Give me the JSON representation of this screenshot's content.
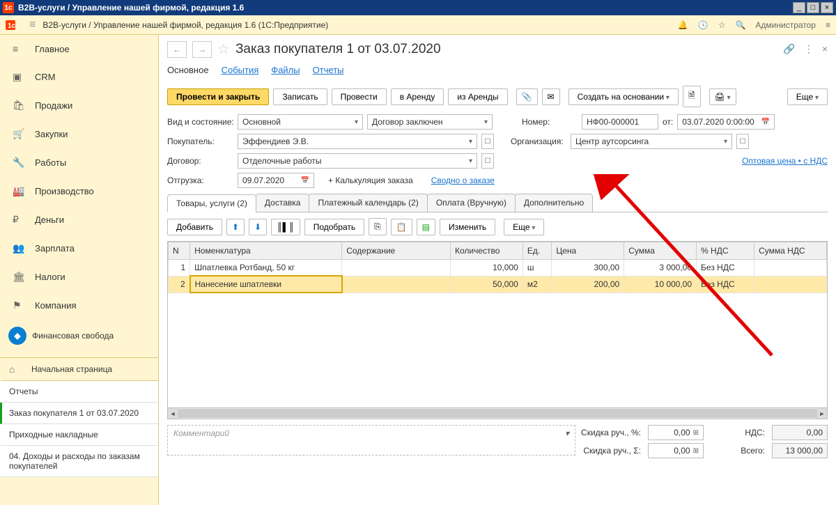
{
  "window": {
    "title": "B2B-услуги / Управление нашей фирмой, редакция 1.6"
  },
  "header": {
    "breadcrumb": "B2B-услуги / Управление нашей фирмой, редакция 1.6  (1С:Предприятие)",
    "user": "Администратор"
  },
  "sidebar": {
    "items": [
      {
        "label": "Главное",
        "icon": "≡"
      },
      {
        "label": "CRM",
        "icon": "▣"
      },
      {
        "label": "Продажи",
        "icon": "🛍"
      },
      {
        "label": "Закупки",
        "icon": "🛒"
      },
      {
        "label": "Работы",
        "icon": "🔧"
      },
      {
        "label": "Производство",
        "icon": "🏭"
      },
      {
        "label": "Деньги",
        "icon": "₽"
      },
      {
        "label": "Зарплата",
        "icon": "👥"
      },
      {
        "label": "Налоги",
        "icon": "🏛"
      },
      {
        "label": "Компания",
        "icon": "⚑"
      }
    ],
    "fin_free": "Финансовая свобода",
    "bottom": [
      {
        "label": "Начальная страница",
        "home": true
      },
      {
        "label": "Отчеты"
      },
      {
        "label": "Заказ покупателя 1 от 03.07.2020",
        "active": true
      },
      {
        "label": "Приходные накладные"
      },
      {
        "label": "04. Доходы и расходы по заказам покупателей"
      }
    ]
  },
  "document": {
    "title": "Заказ покупателя 1 от 03.07.2020",
    "sub_tabs": [
      "Основное",
      "События",
      "Файлы",
      "Отчеты"
    ],
    "actions": {
      "post_close": "Провести и закрыть",
      "save": "Записать",
      "post": "Провести",
      "to_rent": "в Аренду",
      "from_rent": "из Аренды",
      "create_based": "Создать на основании",
      "more": "Еще"
    },
    "fields": {
      "type_state_label": "Вид и состояние:",
      "type": "Основной",
      "state": "Договор заключен",
      "number_label": "Номер:",
      "number": "НФ00-000001",
      "from_label": "от:",
      "date": "03.07.2020  0:00:00",
      "buyer_label": "Покупатель:",
      "buyer": "Эффендиев Э.В.",
      "org_label": "Организация:",
      "org": "Центр аутсорсинга",
      "contract_label": "Договор:",
      "contract": "Отделочные работы",
      "price_link": "Оптовая цена • с НДС",
      "shipment_label": "Отгрузка:",
      "shipment_date": "09.07.2020",
      "calc_link": "+ Калькуляция заказа",
      "summary_link": "Сводно о заказе"
    },
    "tabs": [
      "Товары, услуги (2)",
      "Доставка",
      "Платежный календарь (2)",
      "Оплата (Вручную)",
      "Дополнительно"
    ],
    "table_actions": {
      "add": "Добавить",
      "select": "Подобрать",
      "edit": "Изменить",
      "more": "Еще"
    },
    "columns": [
      "N",
      "Номенклатура",
      "Содержание",
      "Количество",
      "Ед.",
      "Цена",
      "Сумма",
      "% НДС",
      "Сумма НДС"
    ],
    "rows": [
      {
        "n": "1",
        "nomen": "Шпатлевка Ротбанд, 50 кг",
        "content": "",
        "qty": "10,000",
        "unit": "ш",
        "price": "300,00",
        "sum": "3 000,00",
        "vat": "Без НДС",
        "vatsum": ""
      },
      {
        "n": "2",
        "nomen": "Нанесение шпатлевки",
        "content": "",
        "qty": "50,000",
        "unit": "м2",
        "price": "200,00",
        "sum": "10 000,00",
        "vat": "Без НДС",
        "vatsum": ""
      }
    ],
    "footer": {
      "comment_placeholder": "Комментарий",
      "disc_pct_label": "Скидка руч., %:",
      "disc_pct": "0,00",
      "disc_sum_label": "Скидка руч., Σ:",
      "disc_sum": "0,00",
      "vat_label": "НДС:",
      "vat": "0,00",
      "total_label": "Всего:",
      "total": "13 000,00"
    }
  }
}
